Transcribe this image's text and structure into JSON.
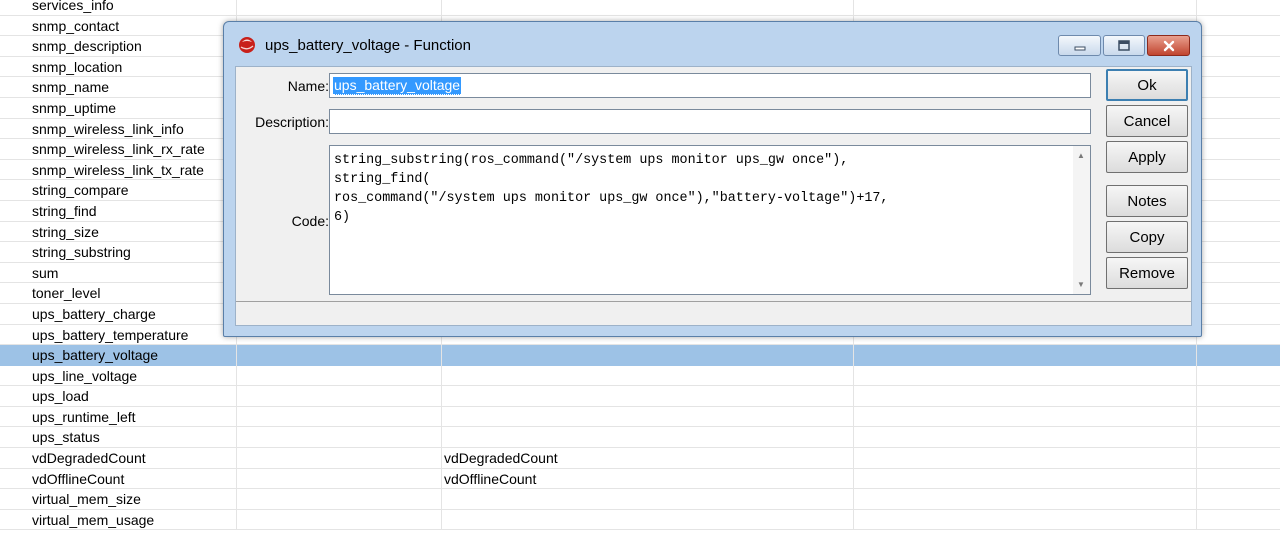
{
  "list": {
    "rows": [
      {
        "name": "services_info",
        "value": ""
      },
      {
        "name": "snmp_contact",
        "value": ""
      },
      {
        "name": "snmp_description",
        "value": ""
      },
      {
        "name": "snmp_location",
        "value": ""
      },
      {
        "name": "snmp_name",
        "value": ""
      },
      {
        "name": "snmp_uptime",
        "value": ""
      },
      {
        "name": "snmp_wireless_link_info",
        "value": ""
      },
      {
        "name": "snmp_wireless_link_rx_rate",
        "value": ""
      },
      {
        "name": "snmp_wireless_link_tx_rate",
        "value": ""
      },
      {
        "name": "string_compare",
        "value": ""
      },
      {
        "name": "string_find",
        "value": ""
      },
      {
        "name": "string_size",
        "value": ""
      },
      {
        "name": "string_substring",
        "value": ""
      },
      {
        "name": "sum",
        "value": ""
      },
      {
        "name": "toner_level",
        "value": ""
      },
      {
        "name": "ups_battery_charge",
        "value": ""
      },
      {
        "name": "ups_battery_temperature",
        "value": ""
      },
      {
        "name": "ups_battery_voltage",
        "value": "",
        "selected": true
      },
      {
        "name": "ups_line_voltage",
        "value": ""
      },
      {
        "name": "ups_load",
        "value": ""
      },
      {
        "name": "ups_runtime_left",
        "value": ""
      },
      {
        "name": "ups_status",
        "value": ""
      },
      {
        "name": "vdDegradedCount",
        "value": "vdDegradedCount"
      },
      {
        "name": "vdOfflineCount",
        "value": "vdOfflineCount"
      },
      {
        "name": "virtual_mem_size",
        "value": ""
      },
      {
        "name": "virtual_mem_usage",
        "value": ""
      }
    ]
  },
  "dialog": {
    "title": "ups_battery_voltage - Function",
    "icon": "app-red-sphere-icon",
    "labels": {
      "name": "Name:",
      "description": "Description:",
      "code": "Code:"
    },
    "name_value": "ups_battery_voltage",
    "description_value": "",
    "code_value": "string_substring(ros_command(\"/system ups monitor ups_gw once\"),\nstring_find(\nros_command(\"/system ups monitor ups_gw once\"),\"battery-voltage\")+17,\n6)",
    "buttons": {
      "ok": "Ok",
      "cancel": "Cancel",
      "apply": "Apply",
      "notes": "Notes",
      "copy": "Copy",
      "remove": "Remove"
    },
    "status": ""
  },
  "colors": {
    "selection": "#9dc2e6",
    "title_bar": "#bcd4ee",
    "close_button": "#c1452f",
    "text_selection": "#3399ff"
  }
}
